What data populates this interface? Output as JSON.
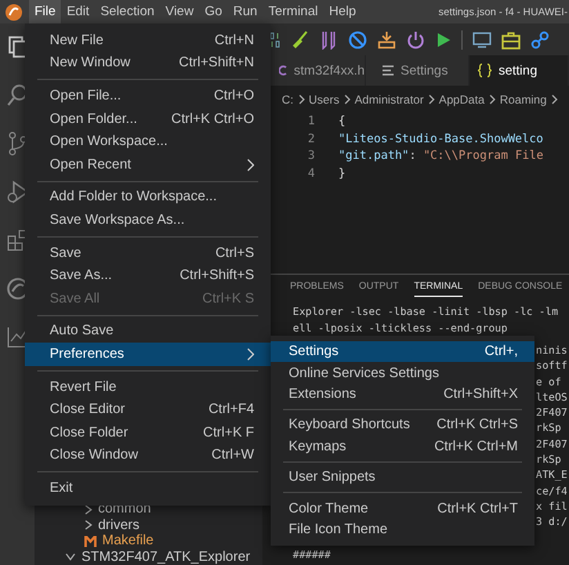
{
  "menubar": {
    "menus": [
      {
        "label": "File",
        "selected": true
      },
      {
        "label": "Edit",
        "selected": false
      },
      {
        "label": "Selection",
        "selected": false
      },
      {
        "label": "View",
        "selected": false
      },
      {
        "label": "Go",
        "selected": false
      },
      {
        "label": "Run",
        "selected": false
      },
      {
        "label": "Terminal",
        "selected": false
      },
      {
        "label": "Help",
        "selected": false
      }
    ],
    "window_title": "settings.json - f4 - HUAWEI-"
  },
  "editor_tabs": [
    {
      "label": "stm32f4xx.h",
      "kind": "c",
      "selected": false
    },
    {
      "label": "Settings",
      "kind": "settings",
      "selected": false
    },
    {
      "label": "setting",
      "kind": "json",
      "selected": true
    }
  ],
  "breadcrumb": [
    "C:",
    "Users",
    "Administrator",
    "AppData",
    "Roaming"
  ],
  "editor_lines": [
    {
      "number": "1",
      "code": [
        {
          "text": "{",
          "kind": "punct"
        }
      ]
    },
    {
      "number": "2",
      "code": [
        {
          "text": "\"Liteos-Studio-Base.ShowWelco",
          "kind": "key"
        }
      ]
    },
    {
      "number": "3",
      "code": [
        {
          "text": "\"git.path\"",
          "kind": "key"
        },
        {
          "text": ": ",
          "kind": "punct"
        },
        {
          "text": "\"C:\\\\Program File",
          "kind": "string"
        }
      ]
    },
    {
      "number": "4",
      "code": [
        {
          "text": "}",
          "kind": "punct"
        }
      ]
    }
  ],
  "panel_tabs": [
    {
      "label": "PROBLEMS",
      "selected": false
    },
    {
      "label": "OUTPUT",
      "selected": false
    },
    {
      "label": "TERMINAL",
      "selected": true
    },
    {
      "label": "DEBUG CONSOLE",
      "selected": false
    }
  ],
  "terminal_lines": [
    "Explorer -lsec -lbase -linit -lbsp -lc -lm",
    "ell -lposix -ltickless --end-group"
  ],
  "terminal_fragments": [
    "ninis",
    "softf",
    "e of",
    "lteOS",
    "2F407",
    "rkSp",
    "2F407",
    "rkSp",
    "ATK_E",
    "ce/f4",
    "x fil",
    "3 d:/"
  ],
  "terminal_last_line": "######",
  "explorer_items": [
    {
      "label": "common",
      "kind": "folder"
    },
    {
      "label": "drivers",
      "kind": "folder"
    },
    {
      "label": "Makefile",
      "kind": "makefile"
    },
    {
      "label": "STM32F407_ATK_Explorer",
      "kind": "open-folder"
    }
  ],
  "file_menu": [
    [
      {
        "label": "New File",
        "shortcut": "Ctrl+N",
        "selected": false,
        "disabled": false,
        "submenu": false
      },
      {
        "label": "New Window",
        "shortcut": "Ctrl+Shift+N",
        "selected": false,
        "disabled": false,
        "submenu": false
      }
    ],
    [
      {
        "label": "Open File...",
        "shortcut": "Ctrl+O",
        "selected": false,
        "disabled": false,
        "submenu": false
      },
      {
        "label": "Open Folder...",
        "shortcut": "Ctrl+K Ctrl+O",
        "selected": false,
        "disabled": false,
        "submenu": false
      },
      {
        "label": "Open Workspace...",
        "selected": false,
        "disabled": false,
        "submenu": false
      },
      {
        "label": "Open Recent",
        "selected": false,
        "disabled": false,
        "submenu": true
      }
    ],
    [
      {
        "label": "Add Folder to Workspace...",
        "selected": false,
        "disabled": false,
        "submenu": false
      },
      {
        "label": "Save Workspace As...",
        "selected": false,
        "disabled": false,
        "submenu": false
      }
    ],
    [
      {
        "label": "Save",
        "shortcut": "Ctrl+S",
        "selected": false,
        "disabled": false,
        "submenu": false
      },
      {
        "label": "Save As...",
        "shortcut": "Ctrl+Shift+S",
        "selected": false,
        "disabled": false,
        "submenu": false
      },
      {
        "label": "Save All",
        "shortcut": "Ctrl+K S",
        "selected": false,
        "disabled": true,
        "submenu": false
      }
    ],
    [
      {
        "label": "Auto Save",
        "selected": false,
        "disabled": false,
        "submenu": false
      },
      {
        "label": "Preferences",
        "selected": true,
        "disabled": false,
        "submenu": true
      }
    ],
    [
      {
        "label": "Revert File",
        "selected": false,
        "disabled": false,
        "submenu": false
      },
      {
        "label": "Close Editor",
        "shortcut": "Ctrl+F4",
        "selected": false,
        "disabled": false,
        "submenu": false
      },
      {
        "label": "Close Folder",
        "shortcut": "Ctrl+K F",
        "selected": false,
        "disabled": false,
        "submenu": false
      },
      {
        "label": "Close Window",
        "shortcut": "Ctrl+W",
        "selected": false,
        "disabled": false,
        "submenu": false
      }
    ],
    [
      {
        "label": "Exit",
        "selected": false,
        "disabled": false,
        "submenu": false
      }
    ]
  ],
  "preferences_menu": [
    [
      {
        "label": "Settings",
        "shortcut": "Ctrl+,",
        "selected": true
      },
      {
        "label": "Online Services Settings",
        "selected": false
      },
      {
        "label": "Extensions",
        "shortcut": "Ctrl+Shift+X",
        "selected": false
      }
    ],
    [
      {
        "label": "Keyboard Shortcuts",
        "shortcut": "Ctrl+K Ctrl+S",
        "selected": false
      },
      {
        "label": "Keymaps",
        "shortcut": "Ctrl+K Ctrl+M",
        "selected": false
      }
    ],
    [
      {
        "label": "User Snippets",
        "selected": false
      }
    ],
    [
      {
        "label": "Color Theme",
        "shortcut": "Ctrl+K Ctrl+T",
        "selected": false
      },
      {
        "label": "File Icon Theme",
        "selected": false
      }
    ]
  ]
}
